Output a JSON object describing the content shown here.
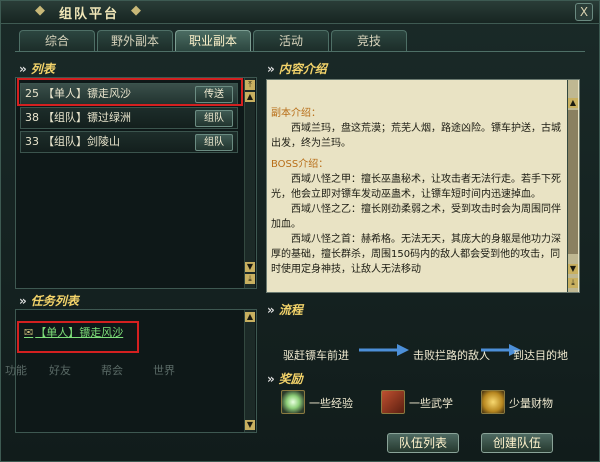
{
  "window": {
    "title": "组队平台",
    "close_label": "X"
  },
  "tabs": [
    {
      "label": "综合"
    },
    {
      "label": "野外副本"
    },
    {
      "label": "职业副本"
    },
    {
      "label": "活动"
    },
    {
      "label": "竞技"
    }
  ],
  "active_tab": 2,
  "list": {
    "heading": "列表",
    "items": [
      {
        "level": "25",
        "name": "【单人】镖走风沙",
        "action": "传送"
      },
      {
        "level": "38",
        "name": "【组队】镖过绿洲",
        "action": "组队"
      },
      {
        "level": "33",
        "name": "【组队】剑陵山",
        "action": "组队"
      }
    ]
  },
  "tasks": {
    "heading": "任务列表",
    "items": [
      {
        "name": "【单人】镖走风沙"
      }
    ],
    "bg_tabs": [
      "功能",
      "好友",
      "帮会",
      "世界"
    ]
  },
  "content": {
    "heading": "内容介绍",
    "intro_label": "副本介绍：",
    "intro_text": "西域兰玛，盘这荒漠；荒芜人烟，路途凶险。镖车护送，古城出发，终为兰玛。",
    "boss_label": "BOSS介绍：",
    "boss_1": "西域八怪之甲：擅长巫蛊秘术，让攻击者无法行走。若手下死光，他会立即对镖车发动巫蛊术，让镖车短时间内迅速掉血。",
    "boss_2": "西域八怪之乙：擅长刚劲柔弱之术，受到攻击时会为周围同伴加血。",
    "boss_3": "西域八怪之首：赫希格。无法无天，其庞大的身躯是他功力深厚的基础，擅长群杀，周围150码内的敌人都会受到他的攻击，同时使用定身神技，让敌人无法移动"
  },
  "flow": {
    "heading": "流程",
    "steps": [
      "驱赶镖车前进",
      "击败拦路的敌人",
      "到达目的地"
    ]
  },
  "rewards": {
    "heading": "奖励",
    "items": [
      {
        "label": "一些经验",
        "icon": "experience-orb-icon"
      },
      {
        "label": "一些武学",
        "icon": "martial-scroll-icon"
      },
      {
        "label": "少量财物",
        "icon": "gold-coins-icon"
      }
    ]
  },
  "buttons": {
    "team_list": "队伍列表",
    "create_team": "创建队伍"
  },
  "colors": {
    "accent": "#f3d36a",
    "highlight": "#d42020",
    "link": "#7ee07a",
    "content_bg": "#e9e3c4"
  }
}
